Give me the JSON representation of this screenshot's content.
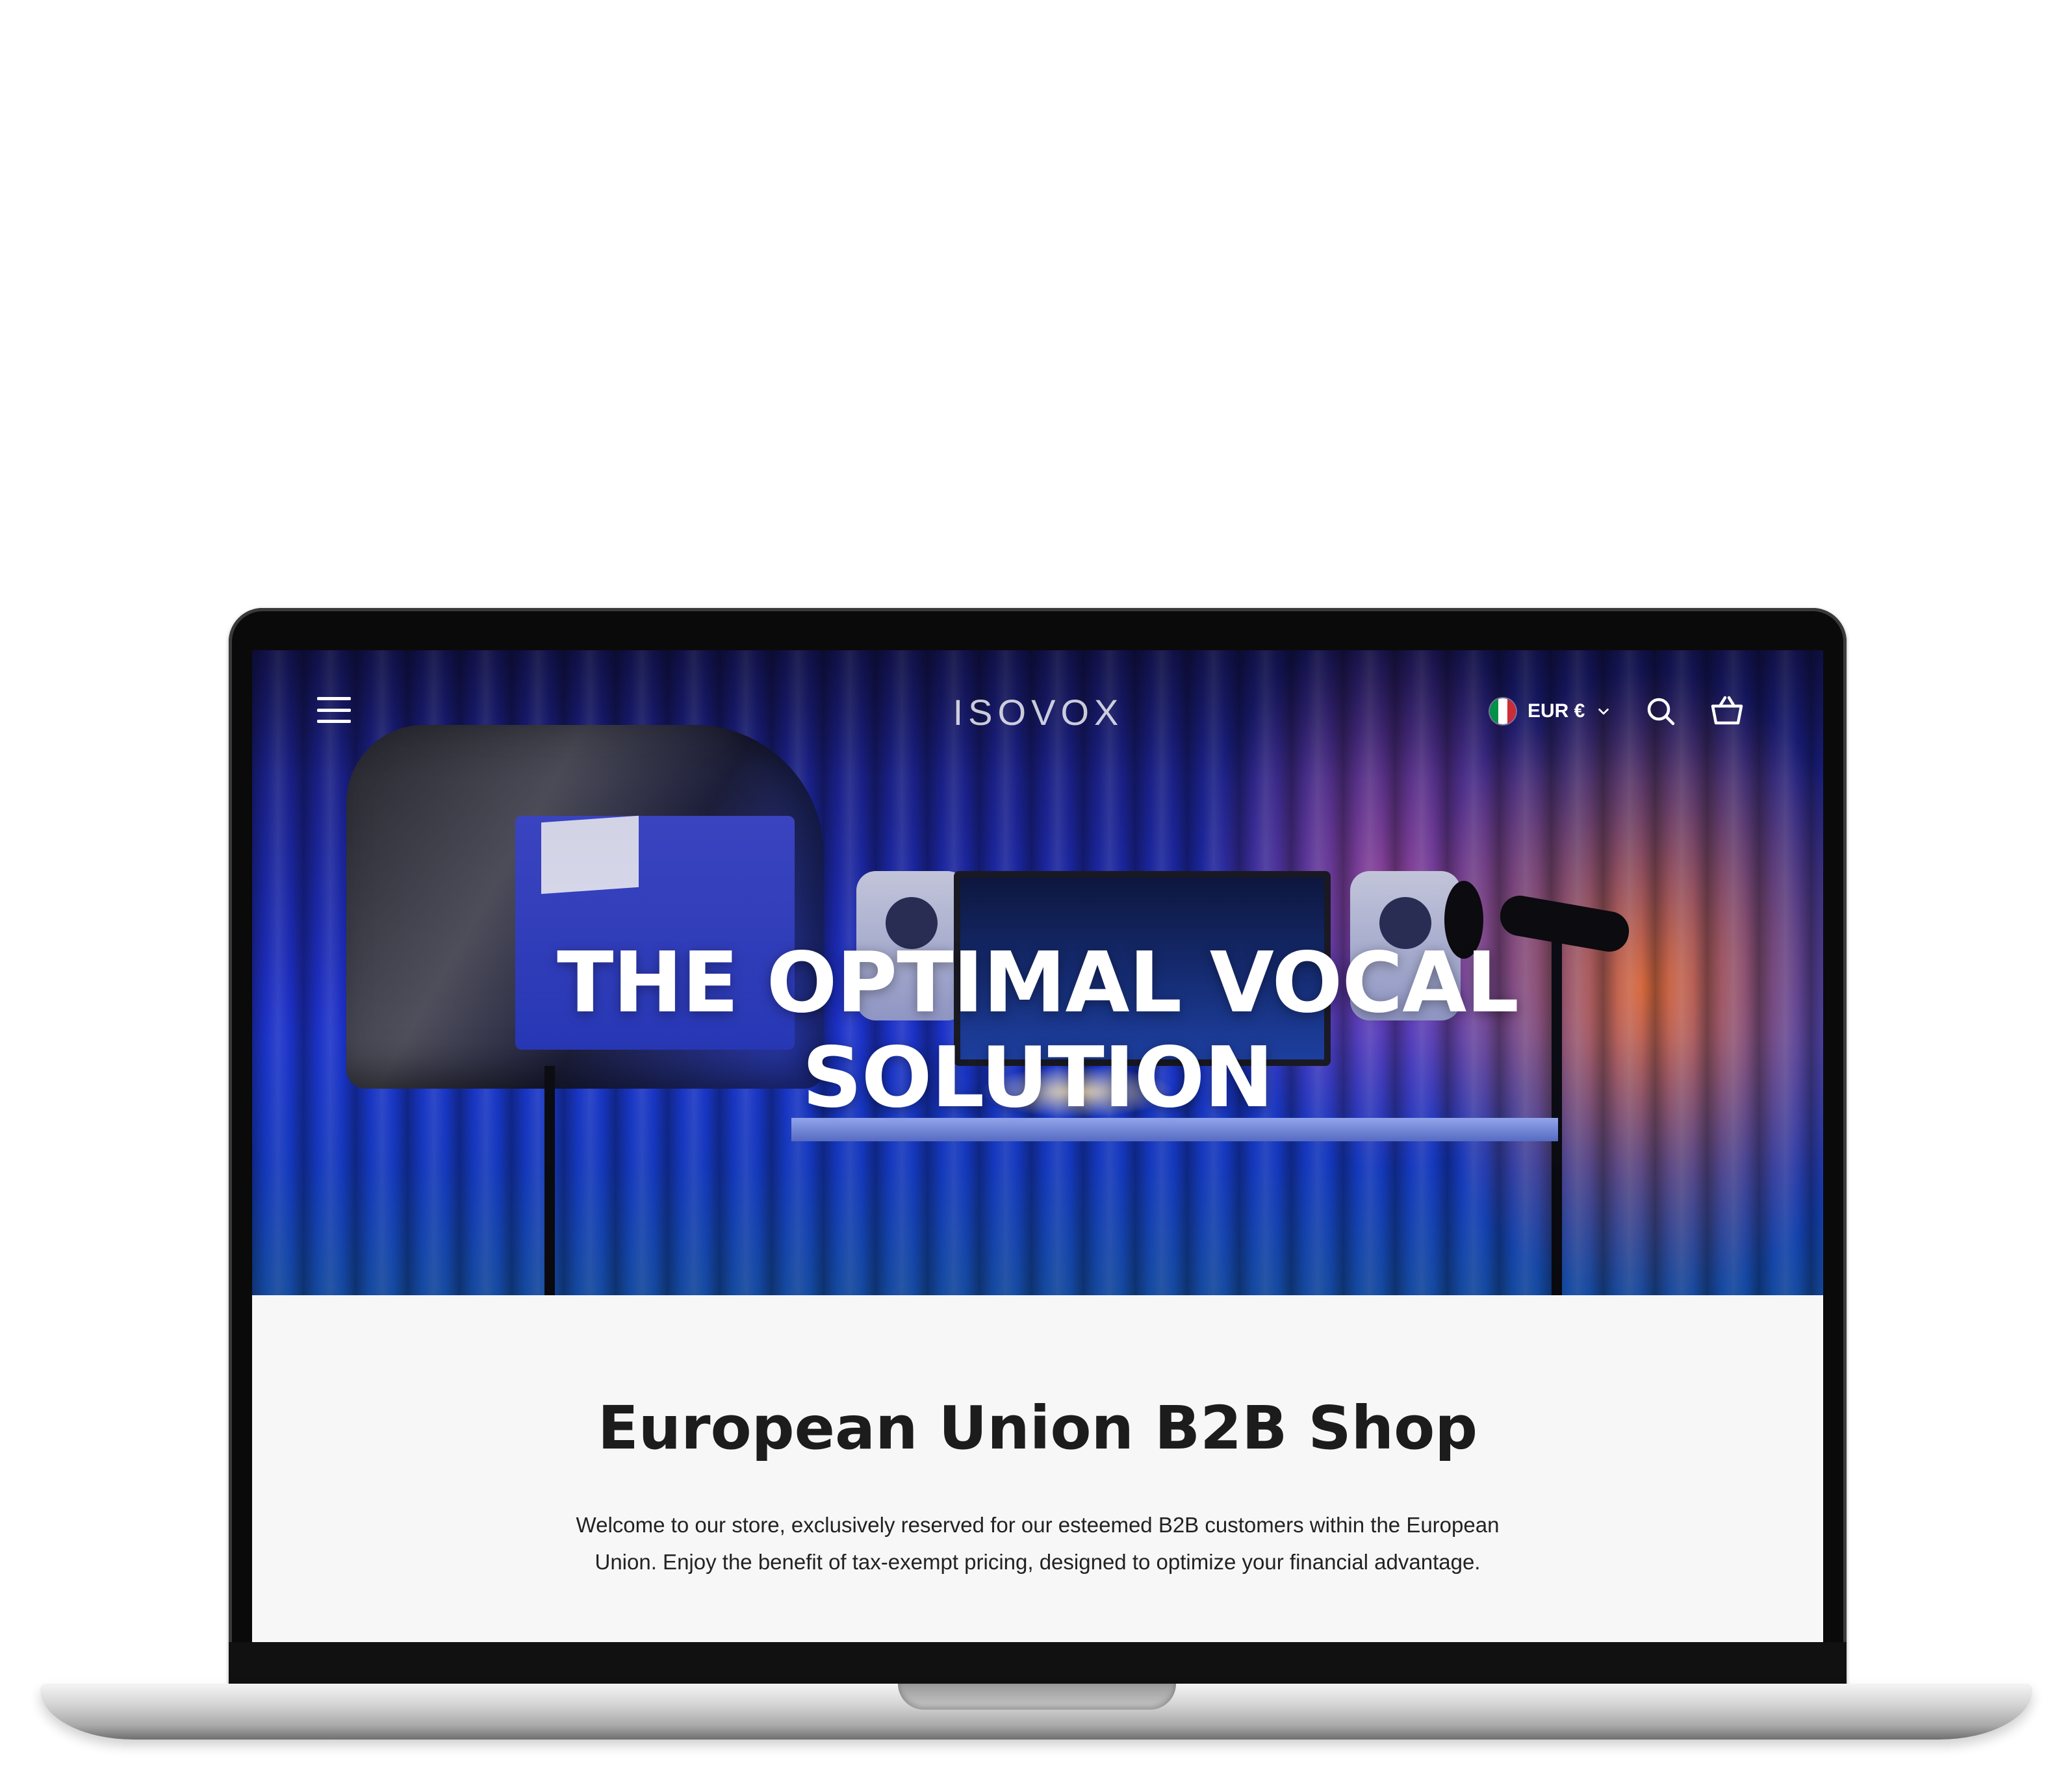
{
  "header": {
    "logo_text": "ISOVOX",
    "currency": {
      "label": "EUR €",
      "flag": "italy-flag"
    },
    "icons": [
      "menu-icon",
      "search-icon",
      "cart-icon",
      "chevron-down-icon"
    ]
  },
  "hero": {
    "title_line1": "THE OPTIMAL VOCAL",
    "title_line2": "SOLUTION"
  },
  "section": {
    "title": "European Union B2B Shop",
    "text": "Welcome to our store, exclusively reserved for our esteemed B2B customers within the European Union. Enjoy the benefit of tax-exempt pricing, designed to optimize your financial advantage."
  },
  "colors": {
    "hero_blue": "#1d2fc4",
    "hero_orange": "#ff7828",
    "content_bg": "#f7f7f7",
    "text_dark": "#1c1c1c",
    "flag_green": "#009246",
    "flag_red": "#ce2b37"
  }
}
